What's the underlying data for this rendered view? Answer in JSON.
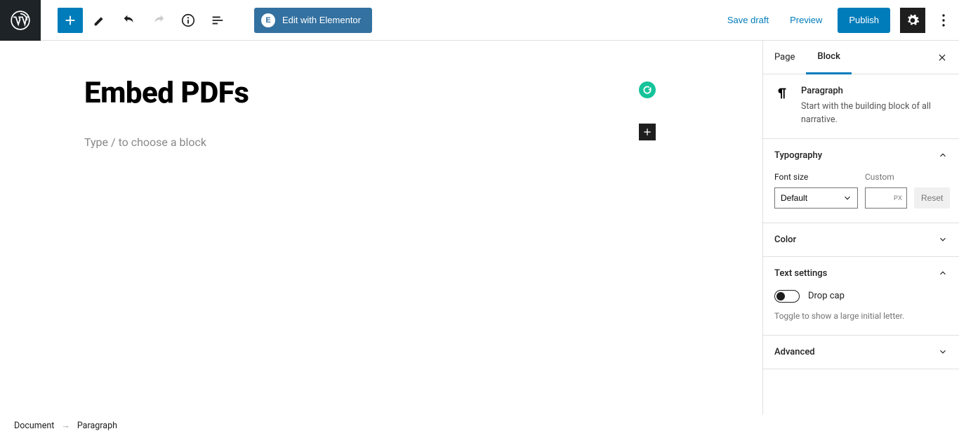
{
  "toolbar": {
    "elementor_label": "Edit with Elementor",
    "save_draft": "Save draft",
    "preview": "Preview",
    "publish": "Publish"
  },
  "editor": {
    "title": "Embed PDFs",
    "placeholder": "Type / to choose a block"
  },
  "sidebar": {
    "tabs": {
      "page": "Page",
      "block": "Block"
    },
    "block_info": {
      "name": "Paragraph",
      "description": "Start with the building block of all narrative."
    },
    "typography": {
      "title": "Typography",
      "font_size_label": "Font size",
      "custom_label": "Custom",
      "default_option": "Default",
      "px_unit": "PX",
      "reset": "Reset"
    },
    "color": {
      "title": "Color"
    },
    "text_settings": {
      "title": "Text settings",
      "drop_cap": "Drop cap",
      "hint": "Toggle to show a large initial letter."
    },
    "advanced": {
      "title": "Advanced"
    }
  },
  "breadcrumb": {
    "root": "Document",
    "current": "Paragraph"
  }
}
